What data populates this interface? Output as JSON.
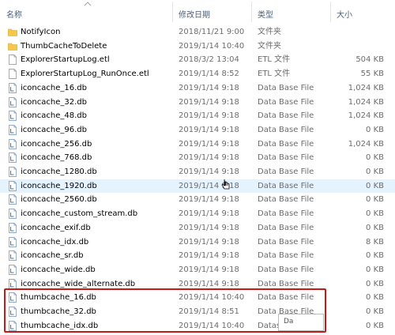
{
  "columns": {
    "name": "名称",
    "date": "修改日期",
    "type": "类型",
    "size": "大小"
  },
  "rows": [
    {
      "icon": "folder-icon",
      "name": "NotifyIcon",
      "date": "2018/11/21 9:00",
      "type": "文件夹",
      "size": ""
    },
    {
      "icon": "folder-icon",
      "name": "ThumbCacheToDelete",
      "date": "2019/1/14 10:40",
      "type": "文件夹",
      "size": ""
    },
    {
      "icon": "file-icon",
      "name": "ExplorerStartupLog.etl",
      "date": "2018/3/2 13:04",
      "type": "ETL 文件",
      "size": "504 KB"
    },
    {
      "icon": "file-icon",
      "name": "ExplorerStartupLog_RunOnce.etl",
      "date": "2019/1/14 8:52",
      "type": "ETL 文件",
      "size": "55 KB"
    },
    {
      "icon": "db-file-icon",
      "name": "iconcache_16.db",
      "date": "2019/1/14 9:18",
      "type": "Data Base File",
      "size": "1,024 KB"
    },
    {
      "icon": "db-file-icon",
      "name": "iconcache_32.db",
      "date": "2019/1/14 9:18",
      "type": "Data Base File",
      "size": "1,024 KB"
    },
    {
      "icon": "db-file-icon",
      "name": "iconcache_48.db",
      "date": "2019/1/14 9:18",
      "type": "Data Base File",
      "size": "1,024 KB"
    },
    {
      "icon": "db-file-icon",
      "name": "iconcache_96.db",
      "date": "2019/1/14 9:18",
      "type": "Data Base File",
      "size": "0 KB"
    },
    {
      "icon": "db-file-icon",
      "name": "iconcache_256.db",
      "date": "2019/1/14 9:18",
      "type": "Data Base File",
      "size": "1,024 KB"
    },
    {
      "icon": "db-file-icon",
      "name": "iconcache_768.db",
      "date": "2019/1/14 9:18",
      "type": "Data Base File",
      "size": "0 KB"
    },
    {
      "icon": "db-file-icon",
      "name": "iconcache_1280.db",
      "date": "2019/1/14 9:18",
      "type": "Data Base File",
      "size": "0 KB"
    },
    {
      "icon": "db-file-icon",
      "name": "iconcache_1920.db",
      "date": "2019/1/14 9:18",
      "type": "Data Base File",
      "size": "0 KB"
    },
    {
      "icon": "db-file-icon",
      "name": "iconcache_2560.db",
      "date": "2019/1/14 9:18",
      "type": "Data Base File",
      "size": "0 KB"
    },
    {
      "icon": "db-file-icon",
      "name": "iconcache_custom_stream.db",
      "date": "2019/1/14 9:18",
      "type": "Data Base File",
      "size": "0 KB"
    },
    {
      "icon": "db-file-icon",
      "name": "iconcache_exif.db",
      "date": "2019/1/14 9:18",
      "type": "Data Base File",
      "size": "0 KB"
    },
    {
      "icon": "db-file-icon",
      "name": "iconcache_idx.db",
      "date": "2019/1/14 9:18",
      "type": "Data Base File",
      "size": "8 KB"
    },
    {
      "icon": "db-file-icon",
      "name": "iconcache_sr.db",
      "date": "2019/1/14 9:18",
      "type": "Data Base File",
      "size": "0 KB"
    },
    {
      "icon": "db-file-icon",
      "name": "iconcache_wide.db",
      "date": "2019/1/14 9:18",
      "type": "Data Base File",
      "size": "0 KB"
    },
    {
      "icon": "db-file-icon",
      "name": "iconcache_wide_alternate.db",
      "date": "2019/1/14 9:18",
      "type": "Data Base File",
      "size": "0 KB"
    },
    {
      "icon": "db-file-icon",
      "name": "thumbcache_16.db",
      "date": "2019/1/14 10:40",
      "type": "Data Base File",
      "size": "0 KB"
    },
    {
      "icon": "db-file-icon",
      "name": "thumbcache_32.db",
      "date": "2019/1/14 8:51",
      "type": "Data Base File",
      "size": "0 KB"
    },
    {
      "icon": "db-file-icon",
      "name": "thumbcache_idx.db",
      "date": "2019/1/14 10:40",
      "type": "Datase",
      "size": "0 KB"
    }
  ],
  "overlay": {
    "text": "Da"
  },
  "colors": {
    "highlight": "#c41a1a",
    "hover_row": "#e5f3ff",
    "header_text": "#4c607a"
  }
}
